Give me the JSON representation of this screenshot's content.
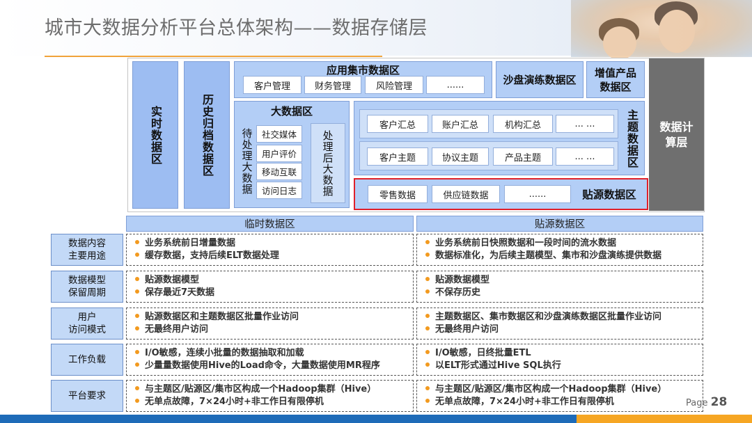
{
  "title": "城市大数据分析平台总体架构——数据存储层",
  "arch": {
    "realtime": "实时数据区",
    "history": "历史归档数据区",
    "app_mart": {
      "title": "应用集市数据区",
      "items": [
        "客户管理",
        "财务管理",
        "风险管理",
        "......"
      ]
    },
    "sandbox": "沙盘演练数据区",
    "value_added": "增值产品数据区",
    "compute": "数据计算层",
    "bigdata": {
      "title": "大数据区",
      "pending": "待处理大数据",
      "items": [
        "社交媒体",
        "用户评价",
        "移动互联",
        "访问日志"
      ],
      "processed": "处理后大数据"
    },
    "subject": {
      "label": "主题数据区",
      "row1": [
        "客户汇总",
        "账户汇总",
        "机构汇总",
        "... ..."
      ],
      "row2": [
        "客户主题",
        "协议主题",
        "产品主题",
        "... ..."
      ]
    },
    "source": {
      "items": [
        "零售数据",
        "供应链数据",
        "......"
      ],
      "label": "贴源数据区"
    }
  },
  "table": {
    "zones": [
      "临时数据区",
      "贴源数据区"
    ],
    "rows": [
      {
        "label": "数据内容\n主要用途",
        "temp": [
          "业务系统前日增量数据",
          "缓存数据，支持后续ELT数据处理"
        ],
        "source": [
          "业务系统前日快照数据和一段时间的流水数据",
          "数据标准化，为后续主题模型、集市和沙盘演练提供数据"
        ]
      },
      {
        "label": "数据模型\n保留周期",
        "temp": [
          "贴源数据模型",
          "保存最近7天数据"
        ],
        "source": [
          "贴源数据模型",
          "不保存历史"
        ]
      },
      {
        "label": "用户\n访问模式",
        "temp": [
          "贴源数据区和主题数据区批量作业访问",
          "无最终用户访问"
        ],
        "source": [
          "主题数据区、集市数据区和沙盘演练数据区批量作业访问",
          "无最终用户访问"
        ]
      },
      {
        "label": "工作负载",
        "temp": [
          "I/O敏感，连续小批量的数据抽取和加载",
          "少量量数据使用Hive的Load命令，大量数据使用MR程序"
        ],
        "source": [
          "I/O敏感，日终批量ETL",
          "以ELT形式通过Hive SQL执行"
        ]
      },
      {
        "label": "平台要求",
        "temp": [
          "与主题区/贴源区/集市区构成一个Hadoop集群（Hive）",
          "无单点故障，7×24小时+非工作日有限停机"
        ],
        "source": [
          "与主题区/贴源区/集市区构成一个Hadoop集群（Hive）",
          "无单点故障，7×24小时+非工作日有限停机"
        ]
      }
    ]
  },
  "page": {
    "label": "Page",
    "number": "28"
  },
  "colors": {
    "accent_orange": "#f0a33a",
    "panel_blue": "#b3cef6",
    "column_blue": "#9dbdf2",
    "compute_gray": "#6f6f6f",
    "highlight_red": "#e0202a",
    "footer_blue": "#1e6bb8",
    "footer_orange": "#f6a623"
  }
}
